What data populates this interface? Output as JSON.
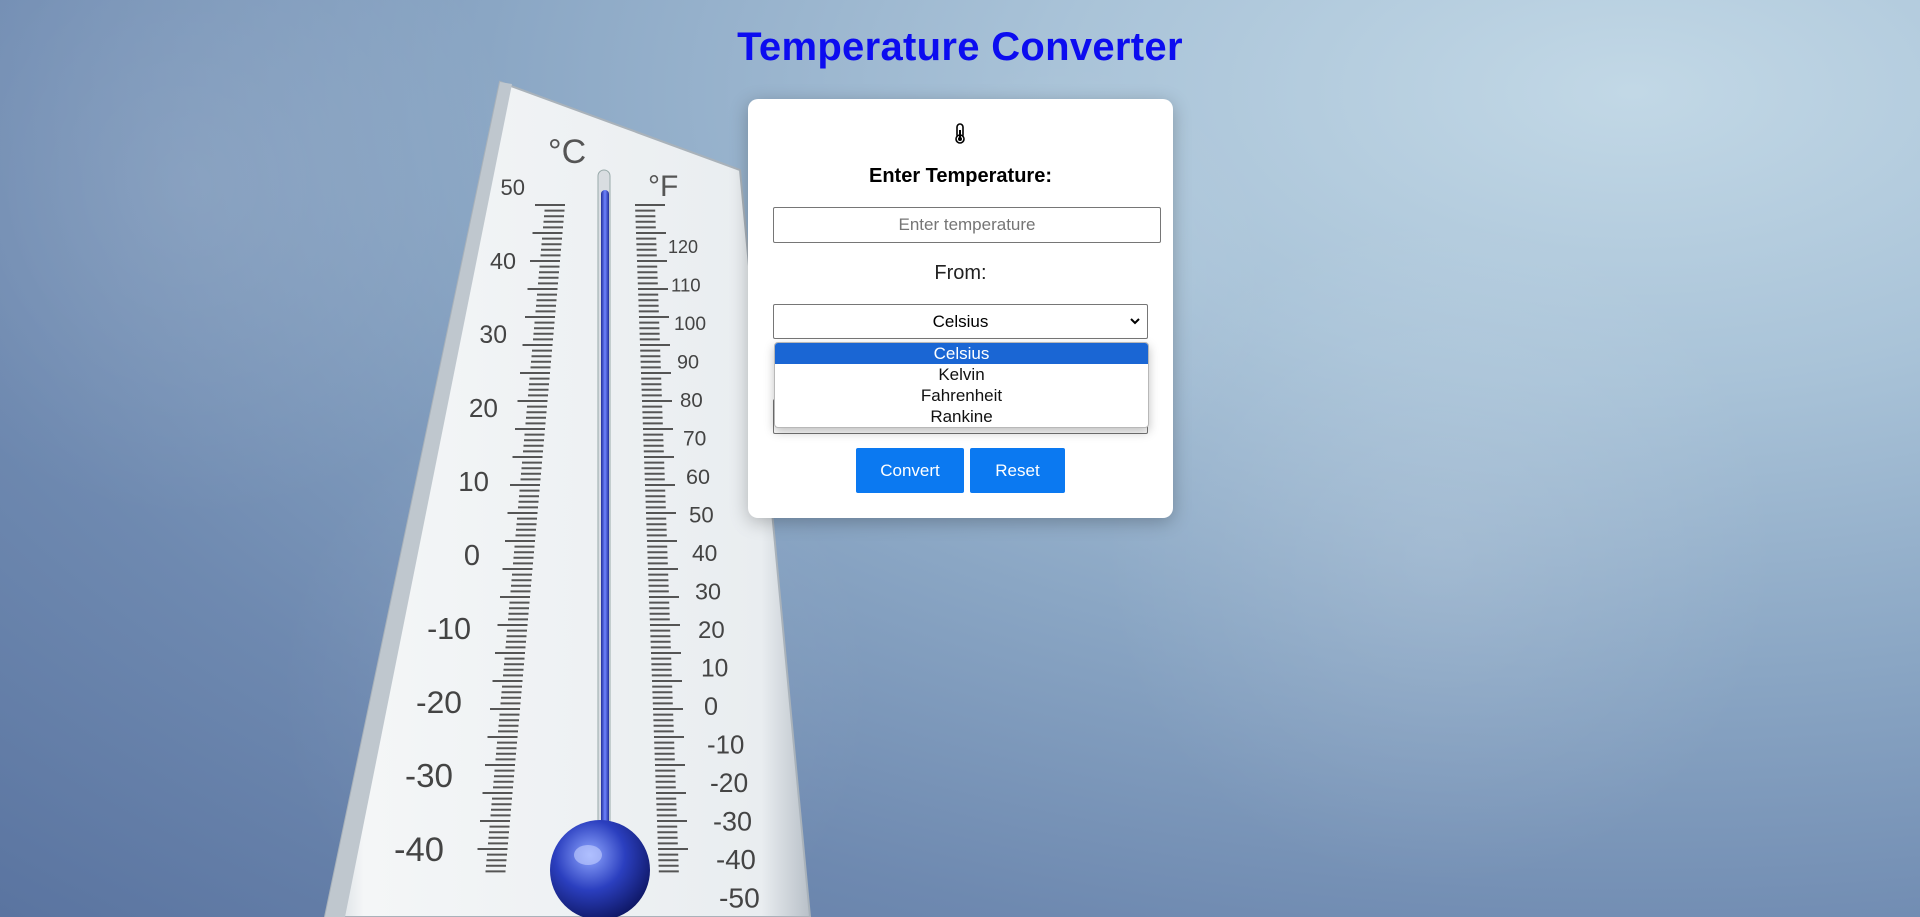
{
  "page": {
    "title": "Temperature Converter"
  },
  "thermometer": {
    "celsius_unit": "°C",
    "fahrenheit_unit": "°F",
    "celsius_ticks": [
      "50",
      "40",
      "30",
      "20",
      "10",
      "0",
      "-10",
      "-20",
      "-30",
      "-40"
    ],
    "fahrenheit_ticks": [
      "120",
      "110",
      "100",
      "90",
      "80",
      "70",
      "60",
      "50",
      "40",
      "30",
      "20",
      "10",
      "0",
      "-10",
      "-20",
      "-30",
      "-40",
      "-50"
    ]
  },
  "form": {
    "icon": "thermometer-icon",
    "enter_label": "Enter Temperature:",
    "temp_placeholder": "Enter temperature",
    "temp_value": "",
    "from_label": "From:",
    "from_selected": "Celsius",
    "from_options": [
      "Celsius",
      "Kelvin",
      "Fahrenheit",
      "Rankine"
    ],
    "convert_label": "Convert",
    "reset_label": "Reset"
  },
  "colors": {
    "title": "#0c0cf0",
    "button": "#0b79f1",
    "option_highlight": "#1a66d4"
  }
}
